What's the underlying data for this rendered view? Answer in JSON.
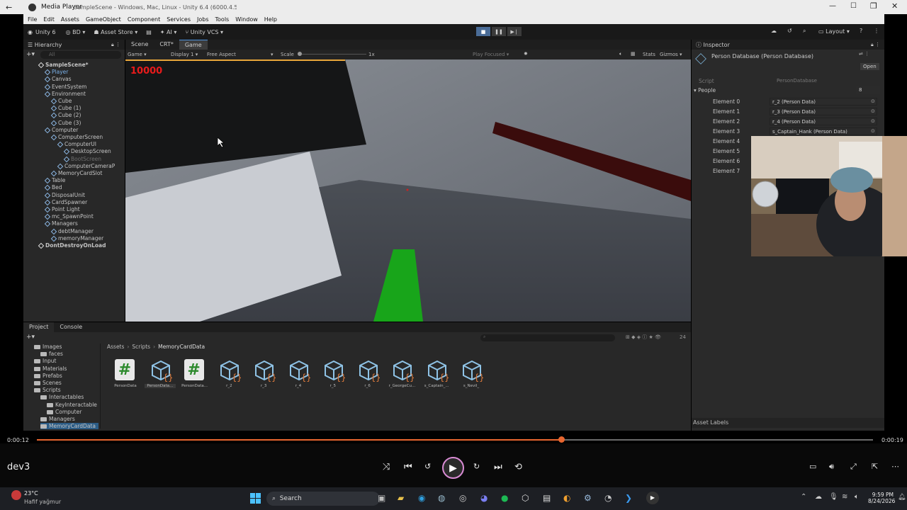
{
  "player": {
    "title": "Media Player",
    "window_title": "SampleScene - Windows, Mac, Linux - Unity 6.4 (6000.4.5f1) <DX12>",
    "time_current": "0:00:12",
    "time_total": "0:00:19",
    "progress": 0.627,
    "channel": "dev3"
  },
  "unity": {
    "menu": [
      "File",
      "Edit",
      "Assets",
      "GameObject",
      "Component",
      "Services",
      "Jobs",
      "Tools",
      "Window",
      "Help"
    ],
    "toolbar": {
      "product": "Unity 6",
      "account": "BD",
      "asset_store": "Asset Store",
      "ai": "AI",
      "vcs": "Unity VCS",
      "layout": "Layout"
    },
    "hierarchy": {
      "title": "Hierarchy",
      "search_placeholder": "All",
      "rows": [
        {
          "label": "SampleScene*",
          "indent": 0,
          "kind": "scene"
        },
        {
          "label": "Player",
          "indent": 1,
          "kind": "prefab"
        },
        {
          "label": "Canvas",
          "indent": 1,
          "kind": "obj"
        },
        {
          "label": "EventSystem",
          "indent": 1,
          "kind": "obj"
        },
        {
          "label": "Environment",
          "indent": 1,
          "kind": "obj"
        },
        {
          "label": "Cube",
          "indent": 2,
          "kind": "obj"
        },
        {
          "label": "Cube (1)",
          "indent": 2,
          "kind": "obj"
        },
        {
          "label": "Cube (2)",
          "indent": 2,
          "kind": "obj"
        },
        {
          "label": "Cube (3)",
          "indent": 2,
          "kind": "obj"
        },
        {
          "label": "Computer",
          "indent": 1,
          "kind": "obj"
        },
        {
          "label": "ComputerScreen",
          "indent": 2,
          "kind": "obj"
        },
        {
          "label": "ComputerUI",
          "indent": 3,
          "kind": "obj"
        },
        {
          "label": "DesktopScreen",
          "indent": 4,
          "kind": "obj"
        },
        {
          "label": "BootScreen",
          "indent": 4,
          "kind": "dim"
        },
        {
          "label": "ComputerCameraP",
          "indent": 3,
          "kind": "obj"
        },
        {
          "label": "MemoryCardSlot",
          "indent": 2,
          "kind": "obj"
        },
        {
          "label": "Table",
          "indent": 1,
          "kind": "obj"
        },
        {
          "label": "Bed",
          "indent": 1,
          "kind": "obj"
        },
        {
          "label": "DisposalUnit",
          "indent": 1,
          "kind": "obj"
        },
        {
          "label": "CardSpawner",
          "indent": 1,
          "kind": "obj"
        },
        {
          "label": "Point Light",
          "indent": 1,
          "kind": "obj"
        },
        {
          "label": "mc_SpawnPoint",
          "indent": 1,
          "kind": "obj"
        },
        {
          "label": "Managers",
          "indent": 1,
          "kind": "obj"
        },
        {
          "label": "debtManager",
          "indent": 2,
          "kind": "obj"
        },
        {
          "label": "memoryManager",
          "indent": 2,
          "kind": "obj"
        },
        {
          "label": "DontDestroyOnLoad",
          "indent": 0,
          "kind": "scene"
        }
      ]
    },
    "scene_tabs": [
      "Scene",
      "CRT*",
      "Game"
    ],
    "game_bar": {
      "mode": "Game",
      "display": "Display 1",
      "aspect": "Free Aspect",
      "scale_label": "Scale",
      "scale_value": "1x",
      "play_focused": "Play Focused",
      "stats": "Stats",
      "gizmos": "Gizmos"
    },
    "game_hud": {
      "money": "10000"
    },
    "inspector": {
      "title": "Inspector",
      "object": "Person Database (Person Database)",
      "open_button": "Open",
      "script_label": "Script",
      "script_value": "PersonDatabase",
      "list_label": "People",
      "list_count": "8",
      "elements": [
        {
          "label": "Element 0",
          "value": "r_2 (Person Data)"
        },
        {
          "label": "Element 1",
          "value": "r_3 (Person Data)"
        },
        {
          "label": "Element 2",
          "value": "r_4 (Person Data)"
        },
        {
          "label": "Element 3",
          "value": "s_Captain_Hank (Person Data)"
        },
        {
          "label": "Element 4",
          "value": ""
        },
        {
          "label": "Element 5",
          "value": ""
        },
        {
          "label": "Element 6",
          "value": ""
        },
        {
          "label": "Element 7",
          "value": ""
        }
      ],
      "asset_labels": "Asset Labels"
    },
    "project": {
      "tabs": [
        "Project",
        "Console"
      ],
      "breadcrumb": [
        "Assets",
        "Scripts",
        "MemoryCardData"
      ],
      "count": "24",
      "tree": [
        {
          "label": "Images",
          "indent": 1
        },
        {
          "label": "faces",
          "indent": 2
        },
        {
          "label": "Input",
          "indent": 1
        },
        {
          "label": "Materials",
          "indent": 1
        },
        {
          "label": "Prefabs",
          "indent": 1
        },
        {
          "label": "Scenes",
          "indent": 1
        },
        {
          "label": "Scripts",
          "indent": 1
        },
        {
          "label": "Interactables",
          "indent": 2
        },
        {
          "label": "KeyInteractable",
          "indent": 3
        },
        {
          "label": "Computer",
          "indent": 3
        },
        {
          "label": "Managers",
          "indent": 2
        },
        {
          "label": "MemoryCardData",
          "indent": 2
        }
      ],
      "assets": [
        {
          "label": "PersonData",
          "kind": "script"
        },
        {
          "label": "PersonData...",
          "kind": "so"
        },
        {
          "label": "PersonData...",
          "kind": "script"
        },
        {
          "label": "r_2",
          "kind": "so"
        },
        {
          "label": "r_3",
          "kind": "so"
        },
        {
          "label": "r_4",
          "kind": "so"
        },
        {
          "label": "r_5",
          "kind": "so"
        },
        {
          "label": "r_6",
          "kind": "so"
        },
        {
          "label": "r_GeorgeCu...",
          "kind": "so"
        },
        {
          "label": "s_Captain_...",
          "kind": "so"
        },
        {
          "label": "s_Nevil_",
          "kind": "so"
        }
      ]
    }
  },
  "taskbar": {
    "weather_temp": "23°C",
    "weather_desc": "Hafif yağmur",
    "search": "Search",
    "time": "9:59 PM",
    "date": "8/24/2026"
  },
  "colors": {
    "progress": "#e8662f",
    "hud_money": "#e81b1b",
    "green_block": "#18a51a"
  }
}
